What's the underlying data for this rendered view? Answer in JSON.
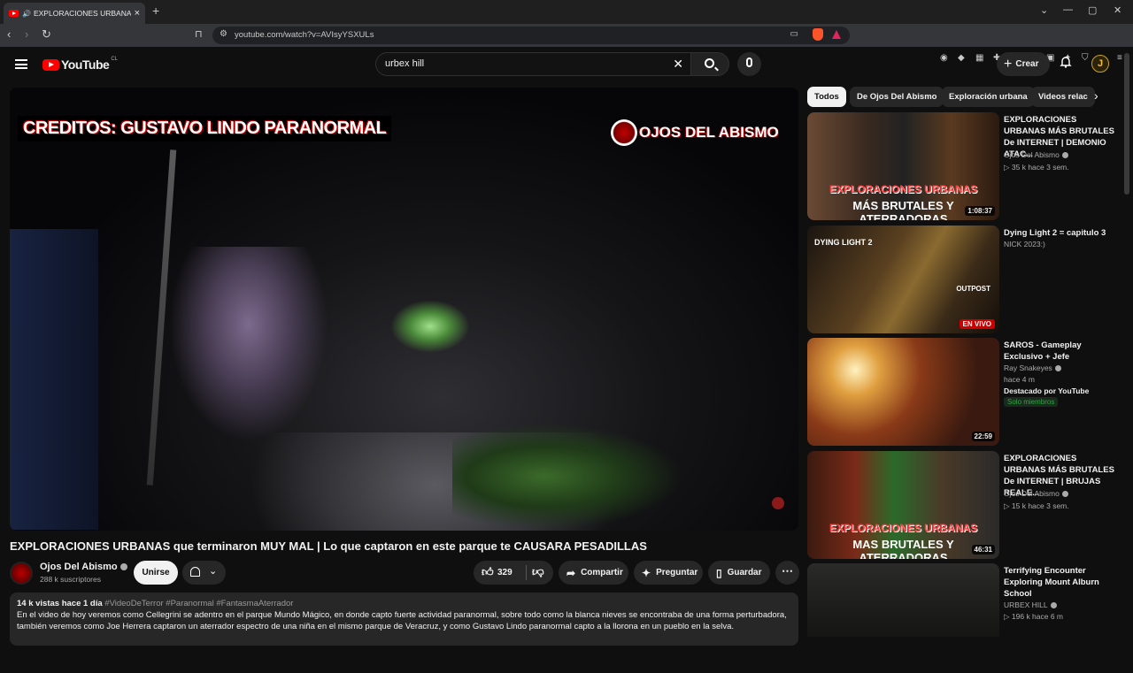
{
  "browser": {
    "tab_title": "EXPLORACIONES URBANAS q",
    "url": "youtube.com/watch?v=AVIsyYSXULs"
  },
  "header": {
    "logo_text": "YouTube",
    "country_code": "CL",
    "search_value": "urbex hill",
    "create_label": "Crear",
    "avatar_letter": "J"
  },
  "player": {
    "overlay_credit": "CREDITOS: GUSTAVO LINDO PARANORMAL",
    "overlay_channel": "OJOS DEL ABISMO"
  },
  "video": {
    "title": "EXPLORACIONES URBANAS que terminaron MUY MAL | Lo que captaron en este parque te CAUSARA PESADILLAS",
    "channel": "Ojos Del Abismo",
    "subscribers": "288 k suscriptores",
    "join_label": "Unirse",
    "likes": "329",
    "share_label": "Compartir",
    "ask_label": "Preguntar",
    "save_label": "Guardar",
    "views_date": "14 k vistas  hace 1 día",
    "hashtags": "#VideoDeTerror #Paranormal #FantasmaAterrador",
    "description_line1": "En el video de hoy veremos como Cellegrini se adentro en el parque Mundo Mágico, en donde capto fuerte actividad paranormal, sobre todo como la blanca nieves se encontraba de una forma perturbadora,",
    "description_line2": "también veremos como Joe Herrera captaron un aterrador espectro de una niña en el mismo parque de Veracruz, y como Gustavo Lindo paranormal capto a la llorona en un pueblo en la selva."
  },
  "sidebar": {
    "chips": [
      "Todos",
      "De Ojos Del Abismo",
      "Exploración urbana",
      "Videos relac"
    ],
    "recommendations": [
      {
        "title": "EXPLORACIONES URBANAS MÁS BRUTALES De INTERNET | DEMONIO ATAC...",
        "channel": "Ojos Del Abismo",
        "meta": "▷ 35 k  hace 3 sem.",
        "duration": "1:08:37",
        "thumb_text_top": "EXPLORACIONES URBANAS",
        "thumb_text_bottom": "MÁS BRUTALES Y ATERRADORAS"
      },
      {
        "title": "Dying Light 2 = capitulo 3",
        "channel": "NICK 2023:)",
        "live_label": "EN VIVO",
        "thumb_text_top": "DYING LIGHT 2",
        "thumb_text_bottom": "OUTPOST"
      },
      {
        "title": "SAROS - Gameplay Exclusivo + Jefe",
        "channel": "Ray Snakeyes",
        "meta": "hace 4 m",
        "note": "Destacado por YouTube",
        "members": "Solo miembros",
        "duration": "22:59"
      },
      {
        "title": "EXPLORACIONES URBANAS MÁS BRUTALES De INTERNET | BRUJAS REALE...",
        "channel": "Ojos Del Abismo",
        "meta": "▷ 15 k  hace 3 sem.",
        "duration": "46:31",
        "thumb_text_top": "EXPLORACIONES URBANAS",
        "thumb_text_bottom": "MAS BRUTALES Y ATERRADORAS"
      },
      {
        "title": "Terrifying Encounter Exploring Mount Alburn School",
        "channel": "URBEX HILL",
        "meta": "▷ 196 k  hace 6 m"
      }
    ]
  }
}
